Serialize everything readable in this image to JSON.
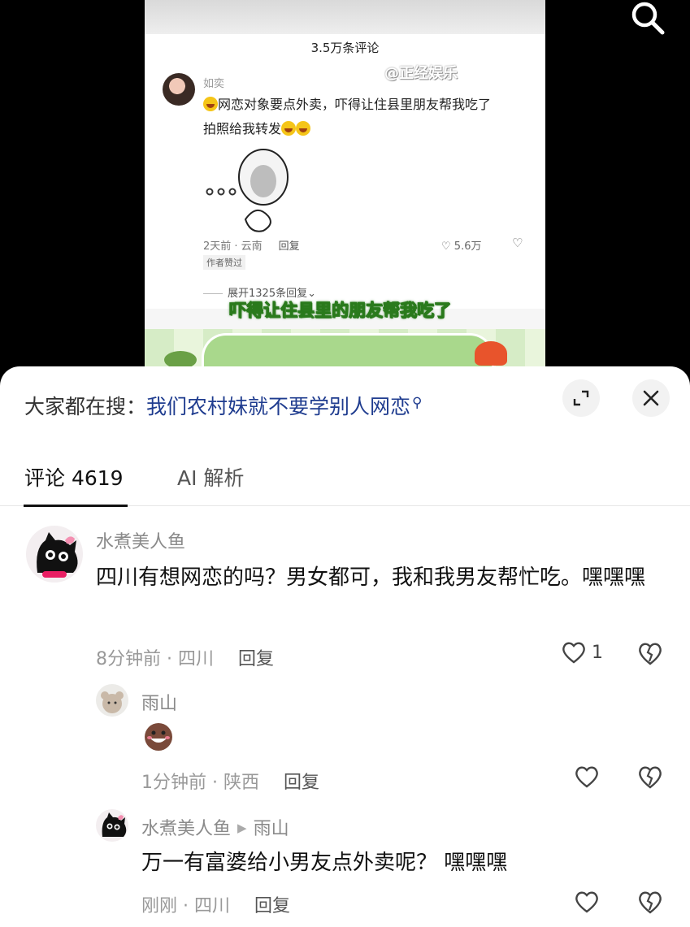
{
  "video": {
    "inner_title": "3.5万条评论",
    "watermark": "@正经娱乐",
    "inner_comment": {
      "name": "如奕",
      "text_line1": "网恋对象要点外卖，吓得让住县里朋友帮我吃了",
      "text_line2": "拍照给我转发",
      "time_location": "2天前 · 云南",
      "reply": "回复",
      "likes": "5.6万",
      "author_liked": "作者赞过",
      "expand": "展开1325条回复"
    },
    "subtitle": "吓得让住县里的朋友帮我吃了"
  },
  "sheet": {
    "search_label": "大家都在搜：",
    "search_query": "我们农村妹就不要学别人网恋",
    "tabs": {
      "comments": "评论 4619",
      "ai": "AI 解析"
    },
    "comments": [
      {
        "name": "水煮美人鱼",
        "text": "四川有想网恋的吗？男女都可，我和我男友帮忙吃。嘿嘿嘿",
        "time_location": "8分钟前 · 四川",
        "reply": "回复",
        "likes": "1"
      }
    ],
    "replies": [
      {
        "name": "雨山",
        "time_location": "1分钟前 · 陕西",
        "reply": "回复"
      },
      {
        "name": "水煮美人鱼",
        "reply_to": "雨山",
        "text": "万一有富婆给小男友点外卖呢？ 嘿嘿嘿",
        "time_location": "刚刚 · 四川",
        "reply": "回复"
      }
    ]
  },
  "colors": {
    "query_blue": "#1f3c8f",
    "subtitle_green": "#2a7a1c"
  }
}
